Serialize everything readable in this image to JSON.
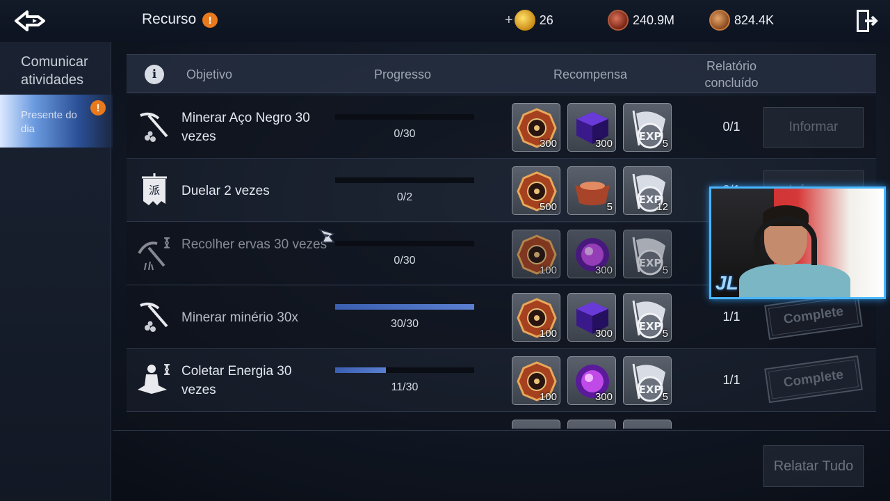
{
  "header": {
    "title": "Recurso",
    "alert": "!",
    "currencies": [
      {
        "name": "gold",
        "plus": "+",
        "value": "26"
      },
      {
        "name": "red-coin",
        "value": "240.9M"
      },
      {
        "name": "bronze-coin",
        "value": "824.4K"
      }
    ]
  },
  "sidebar": {
    "heading": "Comunicar atividades",
    "items": [
      {
        "label": "Presente do dia",
        "alert": "!"
      }
    ]
  },
  "table": {
    "info": "i",
    "columns": {
      "objective": "Objetivo",
      "progress": "Progresso",
      "reward": "Recompensa",
      "report": "Relatório concluído"
    },
    "rows": [
      {
        "icon": "pickaxe-icon",
        "name": "Minerar Aço Negro 30 vezes",
        "progress_text": "0/30",
        "progress": 0,
        "rewards": [
          {
            "icon": "compass-token-icon",
            "qty": "300"
          },
          {
            "icon": "purple-cube-icon",
            "qty": "300"
          },
          {
            "icon": "exp-flag-icon",
            "qty": "5"
          }
        ],
        "report": "0/1",
        "action": "Informar",
        "state": "button"
      },
      {
        "icon": "banner-icon",
        "name": "Duelar 2 vezes",
        "progress_text": "0/2",
        "progress": 0,
        "rewards": [
          {
            "icon": "compass-token-icon",
            "qty": "500"
          },
          {
            "icon": "ingot-icon",
            "qty": "5"
          },
          {
            "icon": "exp-flag-icon",
            "qty": "12"
          }
        ],
        "report": "0/1",
        "action": "Informar",
        "state": "button"
      },
      {
        "icon": "sickle-icon",
        "name": "Recolher ervas 30 vezes",
        "progress_text": "0/30",
        "progress": 0,
        "rewards": [
          {
            "icon": "compass-token-icon",
            "qty": "100"
          },
          {
            "icon": "purple-orb-icon",
            "qty": "300"
          },
          {
            "icon": "exp-flag-icon",
            "qty": "5"
          }
        ],
        "report": "",
        "action": "",
        "state": "hidden"
      },
      {
        "icon": "pickaxe-icon",
        "name": "Minerar minério 30x",
        "progress_text": "30/30",
        "progress": 1.0,
        "rewards": [
          {
            "icon": "compass-token-icon",
            "qty": "100"
          },
          {
            "icon": "purple-cube-icon",
            "qty": "300"
          },
          {
            "icon": "exp-flag-icon",
            "qty": "5"
          }
        ],
        "report": "1/1",
        "action": "Complete",
        "state": "stamp"
      },
      {
        "icon": "meditate-icon",
        "name": "Coletar Energia 30 vezes",
        "progress_text": "11/30",
        "progress": 0.3667,
        "rewards": [
          {
            "icon": "compass-token-icon",
            "qty": "100"
          },
          {
            "icon": "purple-orb-icon",
            "qty": "300"
          },
          {
            "icon": "exp-flag-icon",
            "qty": "5"
          }
        ],
        "report": "1/1",
        "action": "Complete",
        "state": "stamp"
      }
    ]
  },
  "footer": {
    "report_all": "Relatar Tudo"
  },
  "webcam": {
    "badge": "JL"
  }
}
